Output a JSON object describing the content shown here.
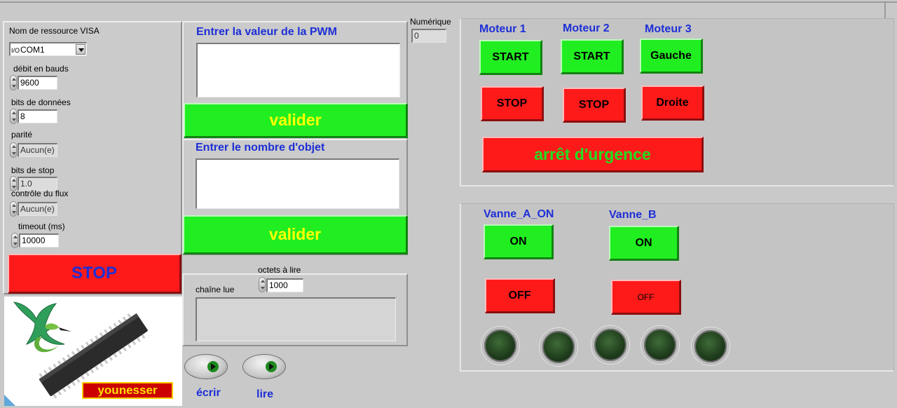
{
  "serial": {
    "visa_label": "Nom de ressource VISA",
    "visa_icon_text": "I/O",
    "visa_value": "COM1",
    "baud_label": "débit en bauds",
    "baud_value": "9600",
    "databits_label": "bits de données",
    "databits_value": "8",
    "parity_label": "parité",
    "parity_value": "Aucun(e)",
    "stopbits_label": "bits de stop",
    "stopbits_value": "1.0",
    "flow_label": "contrôle du flux",
    "flow_value": "Aucun(e)",
    "timeout_label": "timeout (ms)",
    "timeout_value": "10000",
    "stop_button": "STOP"
  },
  "logo": {
    "text": "younesser"
  },
  "pwm": {
    "label": "Entrer la valeur de la PWM",
    "value": "",
    "validate_button": "valider"
  },
  "objects": {
    "label": "Entrer le nombre d'objet",
    "value": "",
    "validate_button": "valider"
  },
  "read": {
    "bytes_label": "octets à lire",
    "bytes_value": "1000",
    "string_label": "chaîne lue",
    "string_value": ""
  },
  "actions": {
    "write_label": "écrir",
    "read_label": "lire"
  },
  "numeric": {
    "label": "Numérique",
    "value": "0"
  },
  "motors": {
    "motor1_label": "Moteur 1",
    "motor2_label": "Moteur 2",
    "motor3_label": "Moteur 3",
    "m1_start": "START",
    "m2_start": "START",
    "m3_left": "Gauche",
    "m1_stop": "STOP",
    "m2_stop": "STOP",
    "m3_right": "Droite",
    "emergency": "arrêt d'urgence"
  },
  "valves": {
    "a_label": "Vanne_A_ON",
    "b_label": "Vanne_B",
    "a_on": "ON",
    "b_on": "ON",
    "a_off": "OFF",
    "b_off": "OFF"
  },
  "colors": {
    "button_green": "#21ee21",
    "button_red": "#ff1a1a",
    "label_blue": "#1d2fd6",
    "valider_text": "#ffff00",
    "emergency_text": "#22dd22",
    "led_off": "#1f3d1c"
  }
}
